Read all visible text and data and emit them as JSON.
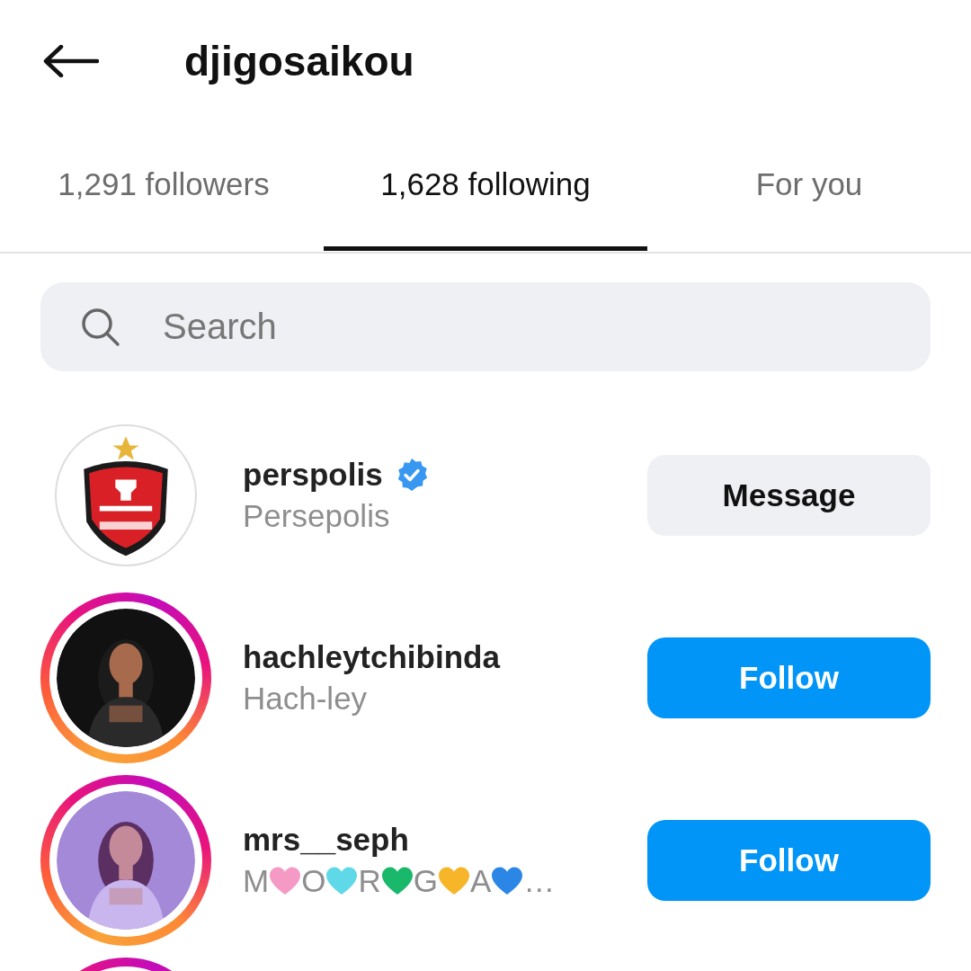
{
  "header": {
    "title": "djigosaikou"
  },
  "tabs": [
    {
      "label": "1,291 followers",
      "selected": false
    },
    {
      "label": "1,628 following",
      "selected": true
    },
    {
      "label": "For you",
      "selected": false
    }
  ],
  "search": {
    "placeholder": "Search"
  },
  "accounts": [
    {
      "avatar": {
        "kind": "logo"
      },
      "story_ring": false,
      "username": "perspolis",
      "verified": true,
      "name_parts": [
        {
          "kind": "text",
          "text": "Persepolis"
        }
      ],
      "button": {
        "kind": "secondary",
        "label": "Message"
      }
    },
    {
      "story_ring": true,
      "username": "hachleytchibinda",
      "verified": false,
      "name_parts": [
        {
          "kind": "text",
          "text": "Hach-ley"
        }
      ],
      "button": {
        "kind": "primary",
        "label": "Follow"
      }
    },
    {
      "story_ring": true,
      "username": "mrs__seph",
      "verified": false,
      "name_parts": [
        {
          "kind": "text",
          "text": "M"
        },
        {
          "kind": "heart",
          "color": "#f59ac4"
        },
        {
          "kind": "text",
          "text": "O"
        },
        {
          "kind": "heart",
          "color": "#5fd8e8"
        },
        {
          "kind": "text",
          "text": "R"
        },
        {
          "kind": "heart",
          "color": "#19b86a"
        },
        {
          "kind": "text",
          "text": "G"
        },
        {
          "kind": "heart",
          "color": "#f7b52a"
        },
        {
          "kind": "text",
          "text": "A"
        },
        {
          "kind": "heart",
          "color": "#2b86e6"
        },
        {
          "kind": "text",
          "text": "…"
        }
      ],
      "button": {
        "kind": "primary",
        "label": "Follow"
      }
    },
    {
      "story_ring": true
    }
  ]
}
